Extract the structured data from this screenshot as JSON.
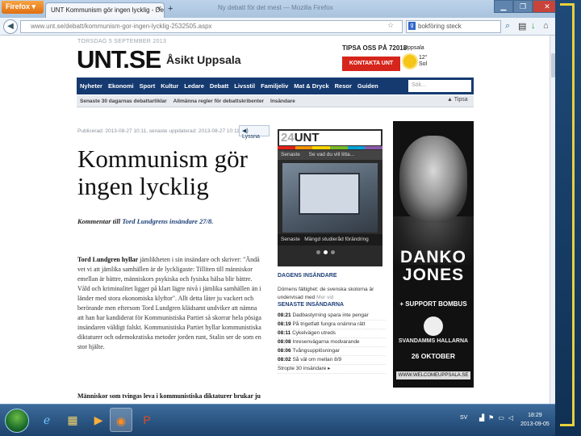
{
  "browser": {
    "menu_button": "Firefox ▾",
    "tab_title": "UNT Kommunism gör ingen lycklig - Debatt - ...",
    "window_title": "Ny debatt för det mest — Mozilla Firefox",
    "url": "www.unt.se/debatt/kommunism-gor-ingen-lycklig-2532505.aspx",
    "search_value": "bokföring steck"
  },
  "site": {
    "date": "TORSDAG 5 SEPTEMBER 2013",
    "logo": "UNT.SE",
    "section": "Åsikt Uppsala",
    "tips": "TIPSA OSS PÅ 72018",
    "contact_button": "KONTAKTA UNT",
    "weather_city": "Uppsala",
    "weather_temp": "12°",
    "weather_desc": "Sol",
    "search_placeholder": "Sök..."
  },
  "nav": {
    "items": [
      "Nyheter",
      "Ekonomi",
      "Sport",
      "Kultur",
      "Ledare",
      "Debatt",
      "Livsstil",
      "Familjeliv",
      "Mat & Dryck",
      "Resor",
      "Guiden"
    ]
  },
  "subnav": {
    "items": [
      "Senaste 30 dagarnas debattartiklar",
      "Allmänna regler för debattskribenter",
      "Insändare"
    ],
    "tipsa": "▲ Tipsa"
  },
  "article": {
    "meta": "Publicerad: 2013-08-27 10:11, senaste uppdaterad: 2013-08-27 10:11",
    "listen": "◀) Lyssna",
    "headline": "Kommunism gör ingen lycklig",
    "lead_prefix": "Kommentar till ",
    "lead_link": "Tord Lundgrens insändare 27/8.",
    "body_strong": "Tord Lundgren hyllar",
    "body": " jämlikheten i sin insändare och skriver: \"Ändå vet vi att jämlika samhällen är de lyckligaste: Tilliten till människor emellan är bättre, människors psykiska och fysiska hälsa blir bättre. Våld och kriminalitet ligger på klart lägre nivå i jämlika samhällen än i länder med stora ekonomiska klyftor\". Allt detta låter ju vackert och berörande men eftersom Tord Lundgren klädsamt undviker att nämna att han har kandiderat för Kommunistiska Partiet så skorrar hela pösiga insändaren väldigt falskt. Kommunistiska Partiet hyllar kommunistiska diktaturer och odemokratiska metoder jorden runt, Stalin ser de som en stor hjälte.",
    "body2": "Människor som tvingas leva i kommunistiska diktaturer brukar ju"
  },
  "widget24": {
    "logo_a": "24",
    "logo_b": "UNT",
    "tabs": "Senaste      Se vad du vill titta...",
    "caption": "Senaste   Mängd studieråd förändring",
    "stripe_colors": [
      "#e2231a",
      "#f39200",
      "#ffd500",
      "#7ab929",
      "#00a0d6",
      "#8b59a7"
    ]
  },
  "dagens": {
    "heading": "DAGENS INSÄNDARE",
    "text": "Dömens fältighet: de svenska skolorna är undervisad med",
    "link": "Mer vid"
  },
  "insandare": {
    "heading": "SENASTE INSÄNDARNA",
    "items": [
      {
        "time": "08:21",
        "text": "Dadbastyrning spara inte pengar"
      },
      {
        "time": "08:19",
        "text": "På trigetfatt fungra onämna rätt"
      },
      {
        "time": "08:11",
        "text": "Cykelvägen utreds"
      },
      {
        "time": "08:08",
        "text": "Inresenvägarna modvarande"
      },
      {
        "time": "08:06",
        "text": "Tvångsupplösningar"
      },
      {
        "time": "08:02",
        "text": "Så väl om mellan 8/9"
      },
      {
        "time": "",
        "text": "Stropte 30 insändare ▸"
      }
    ]
  },
  "ad": {
    "title": "DANKO JONES",
    "support": "+ SUPPORT BOMBUS",
    "venue": "SVANDAMMS HALLARNA",
    "date": "26 OKTOBER",
    "url": "WWW.WELCOMEUPPSALA.SE"
  },
  "taskbar": {
    "lang": "SV",
    "time": "18:29",
    "date": "2013-09-05"
  }
}
